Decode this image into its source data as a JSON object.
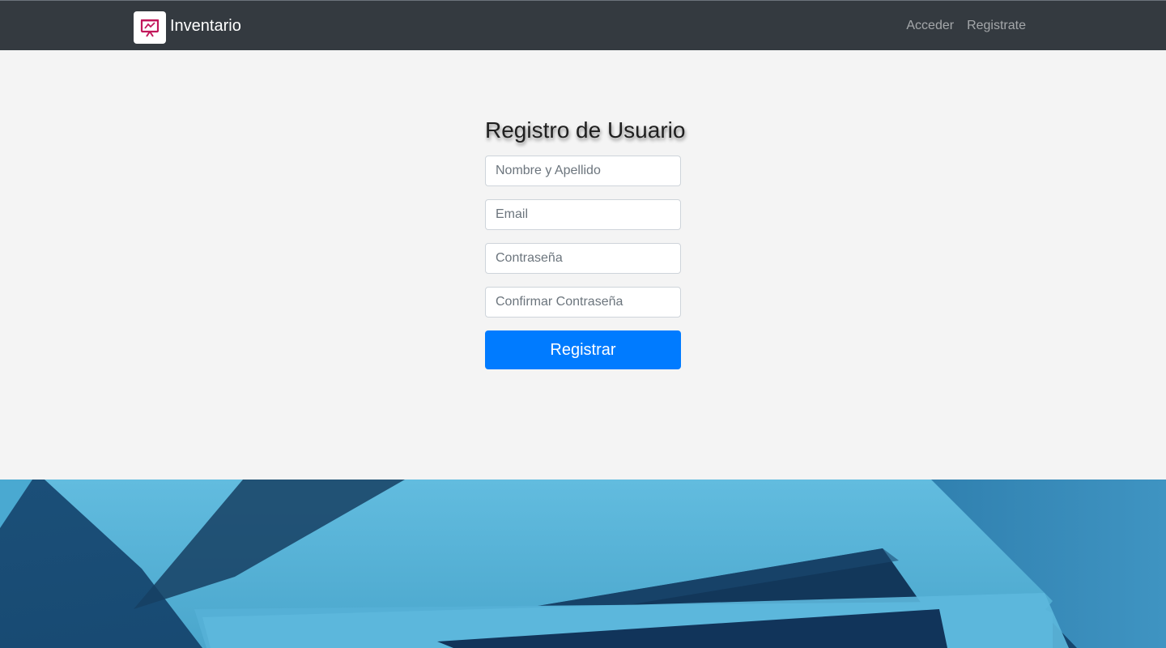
{
  "navbar": {
    "brand": {
      "icon": "presentation-chart-icon",
      "title": "Inventario"
    },
    "links": [
      {
        "label": "Acceder"
      },
      {
        "label": "Registrate"
      }
    ]
  },
  "register_form": {
    "title": "Registro de Usuario",
    "fields": {
      "name": {
        "value": "",
        "placeholder": "Nombre y Apellido"
      },
      "email": {
        "value": "",
        "placeholder": "Email"
      },
      "password": {
        "value": "",
        "placeholder": "Contraseña"
      },
      "confirm_password": {
        "value": "",
        "placeholder": "Confirmar Contraseña"
      }
    },
    "submit_label": "Registrar"
  },
  "colors": {
    "navbar_bg": "#343a40",
    "page_bg": "#f4f4f4",
    "primary_button": "#007bff",
    "brand_icon": "#c2185b",
    "hero_light_blue": "#5bb6d9",
    "hero_dark_blue": "#1e5a84"
  }
}
